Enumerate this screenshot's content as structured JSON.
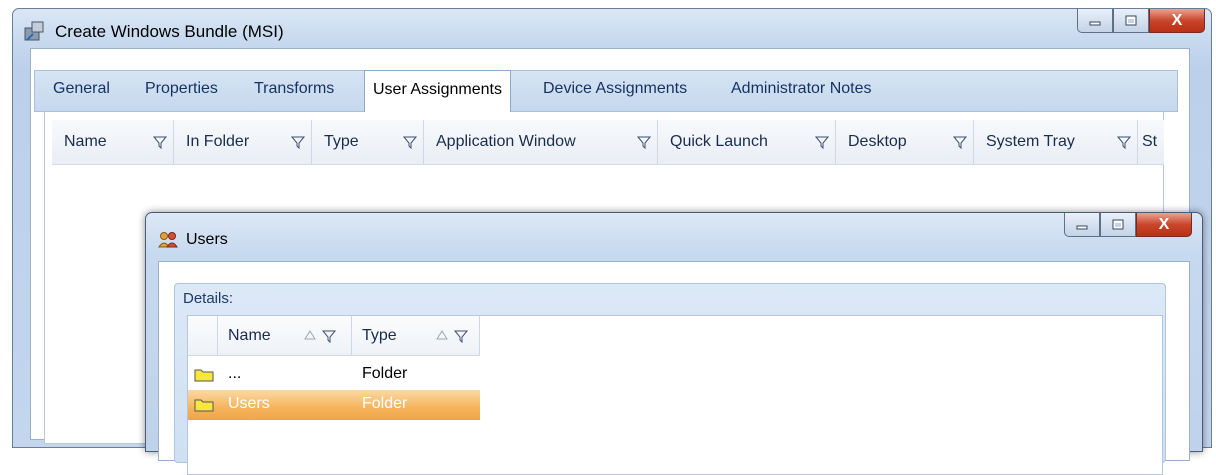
{
  "window": {
    "title": "Create Windows Bundle (MSI)"
  },
  "tabs": [
    "General",
    "Properties",
    "Transforms",
    "User Assignments",
    "Device Assignments",
    "Administrator Notes"
  ],
  "active_tab": "User Assignments",
  "grid_columns": [
    "Name",
    "In Folder",
    "Type",
    "Application Window",
    "Quick Launch",
    "Desktop",
    "System Tray",
    "St"
  ],
  "dialog": {
    "title": "Users",
    "details_label": "Details:",
    "columns": [
      "Name",
      "Type"
    ],
    "rows": [
      {
        "name": "...",
        "type": "Folder",
        "selected": false
      },
      {
        "name": "Users",
        "type": "Folder",
        "selected": true
      }
    ]
  },
  "controls": {
    "minimize": "minimize-icon",
    "maximize": "maximize-icon",
    "close": "X"
  },
  "colors": {
    "selection": "#f5b35c",
    "accent": "#15325f",
    "close_button": "#c9462c"
  }
}
